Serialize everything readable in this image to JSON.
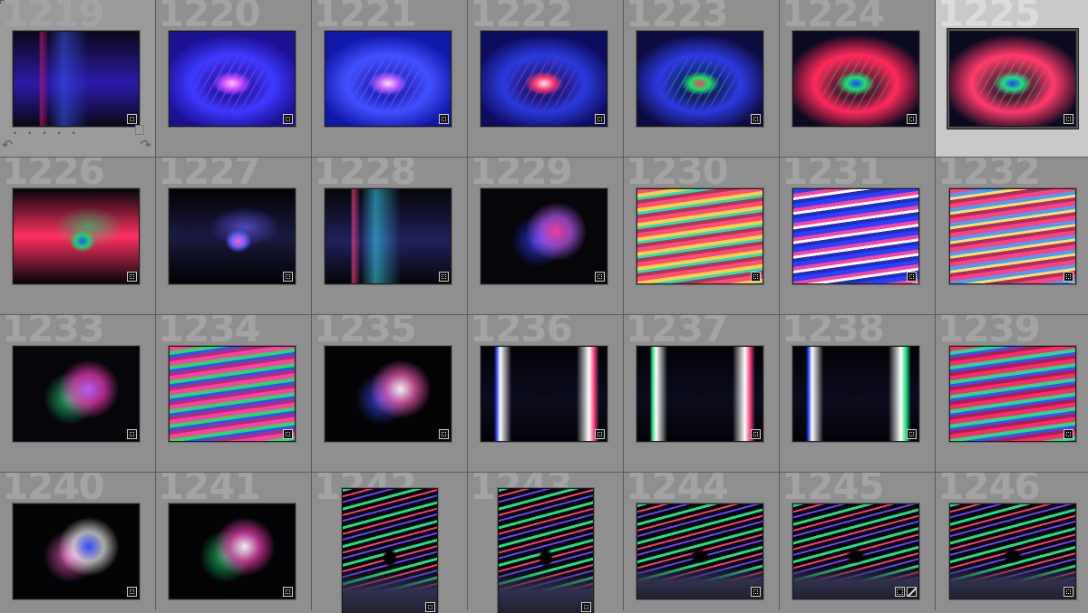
{
  "window": {
    "app": "Lightroom Library Grid"
  },
  "colors": {
    "cell_bg": "#8f8f8f",
    "cell_selected_bg": "#c9c9c9",
    "index_number": "#a3a3a3",
    "grid_line": "#5a5a5a"
  },
  "hover_controls": {
    "stars": "• • • • •",
    "rotate_left_icon": "rotate-left-icon",
    "rotate_right_icon": "rotate-right-icon"
  },
  "cells": [
    {
      "index": "1219",
      "orientation": "landscape",
      "selected": false,
      "hover": true,
      "palette": [
        "#0a0818",
        "#2a1aa8",
        "#c0146a",
        "#3a5af0"
      ],
      "style": "subway"
    },
    {
      "index": "1220",
      "orientation": "landscape",
      "selected": false,
      "palette": [
        "#1a1090",
        "#3d38ff",
        "#c84cff",
        "#ffc0ff"
      ],
      "style": "tunnel"
    },
    {
      "index": "1221",
      "orientation": "landscape",
      "selected": false,
      "palette": [
        "#1018a8",
        "#4050ff",
        "#c060ff",
        "#ffe0ff"
      ],
      "style": "tunnel"
    },
    {
      "index": "1222",
      "orientation": "landscape",
      "selected": false,
      "palette": [
        "#0c0c60",
        "#2a3adc",
        "#ff3a6a",
        "#ffe6ff"
      ],
      "style": "tunnel"
    },
    {
      "index": "1223",
      "orientation": "landscape",
      "selected": false,
      "palette": [
        "#0c0c40",
        "#2c3ae0",
        "#20e060",
        "#ff3a6a"
      ],
      "style": "tunnel"
    },
    {
      "index": "1224",
      "orientation": "landscape",
      "selected": false,
      "palette": [
        "#0a0a20",
        "#ff2a5a",
        "#20e070",
        "#2040ff"
      ],
      "style": "tunnel"
    },
    {
      "index": "1225",
      "orientation": "landscape",
      "selected": true,
      "palette": [
        "#0a0a20",
        "#ff3a6a",
        "#20e080",
        "#2040ff"
      ],
      "style": "tunnel"
    },
    {
      "index": "1226",
      "orientation": "landscape",
      "selected": false,
      "palette": [
        "#05050a",
        "#ff3060",
        "#20d070",
        "#3050ff"
      ],
      "style": "tunnel-dark"
    },
    {
      "index": "1227",
      "orientation": "landscape",
      "selected": false,
      "palette": [
        "#020204",
        "#1a1a40",
        "#6a60ff",
        "#ff60c0"
      ],
      "style": "tunnel-dark"
    },
    {
      "index": "1228",
      "orientation": "landscape",
      "selected": false,
      "palette": [
        "#05060a",
        "#20205a",
        "#ff4080",
        "#40e0ff"
      ],
      "style": "subway"
    },
    {
      "index": "1229",
      "orientation": "landscape",
      "selected": false,
      "palette": [
        "#05050a",
        "#3040ff",
        "#c060ff",
        "#ff40a0"
      ],
      "style": "blur"
    },
    {
      "index": "1230",
      "orientation": "landscape",
      "selected": false,
      "palette": [
        "#200810",
        "#ff4a7a",
        "#ffd040",
        "#20e0c0"
      ],
      "style": "streak"
    },
    {
      "index": "1231",
      "orientation": "landscape",
      "selected": false,
      "palette": [
        "#0a0a30",
        "#2a40ff",
        "#ff40a0",
        "#ffffff"
      ],
      "style": "streak"
    },
    {
      "index": "1232",
      "orientation": "landscape",
      "selected": false,
      "palette": [
        "#0a0a20",
        "#ff4080",
        "#40a0ff",
        "#ffe060"
      ],
      "style": "streak"
    },
    {
      "index": "1233",
      "orientation": "landscape",
      "selected": false,
      "palette": [
        "#05050a",
        "#20e080",
        "#ff40c0",
        "#c060ff"
      ],
      "style": "blur"
    },
    {
      "index": "1234",
      "orientation": "landscape",
      "selected": false,
      "palette": [
        "#0a0a30",
        "#ff40a0",
        "#20e060",
        "#3050ff"
      ],
      "style": "streak"
    },
    {
      "index": "1235",
      "orientation": "landscape",
      "selected": false,
      "palette": [
        "#030305",
        "#4050ff",
        "#ff60c0",
        "#ffffff"
      ],
      "style": "blur"
    },
    {
      "index": "1236",
      "orientation": "landscape",
      "selected": false,
      "palette": [
        "#020206",
        "#2a3aff",
        "#ffffff",
        "#ff4080"
      ],
      "style": "corridor"
    },
    {
      "index": "1237",
      "orientation": "landscape",
      "selected": false,
      "palette": [
        "#020206",
        "#20e080",
        "#ffffff",
        "#ff4080"
      ],
      "style": "corridor"
    },
    {
      "index": "1238",
      "orientation": "landscape",
      "selected": false,
      "palette": [
        "#020206",
        "#2040ff",
        "#ffffff",
        "#20e080"
      ],
      "style": "corridor"
    },
    {
      "index": "1239",
      "orientation": "landscape",
      "selected": false,
      "palette": [
        "#0a0820",
        "#ff2a6a",
        "#20e080",
        "#3a50ff"
      ],
      "style": "streak"
    },
    {
      "index": "1240",
      "orientation": "landscape",
      "selected": false,
      "palette": [
        "#030305",
        "#ff60d0",
        "#ffffff",
        "#3050ff"
      ],
      "style": "blur"
    },
    {
      "index": "1241",
      "orientation": "landscape",
      "selected": false,
      "palette": [
        "#030305",
        "#20e070",
        "#ff40c0",
        "#ffffff"
      ],
      "style": "blur"
    },
    {
      "index": "1242",
      "orientation": "portrait",
      "selected": false,
      "palette": [
        "#05050c",
        "#20e080",
        "#ff3a6a",
        "#6a40ff"
      ],
      "style": "mural"
    },
    {
      "index": "1243",
      "orientation": "portrait",
      "selected": false,
      "palette": [
        "#05050c",
        "#20e080",
        "#ff3a6a",
        "#6a40ff"
      ],
      "style": "mural"
    },
    {
      "index": "1244",
      "orientation": "landscape",
      "selected": false,
      "palette": [
        "#05050c",
        "#20e080",
        "#ff3a6a",
        "#6a40ff"
      ],
      "style": "mural"
    },
    {
      "index": "1245",
      "orientation": "landscape",
      "selected": false,
      "palette": [
        "#05050c",
        "#20e080",
        "#ff3a6a",
        "#6a40ff"
      ],
      "style": "mural",
      "edited": true
    },
    {
      "index": "1246",
      "orientation": "landscape",
      "selected": false,
      "palette": [
        "#05050c",
        "#20e080",
        "#ff3a6a",
        "#6a40ff"
      ],
      "style": "mural"
    }
  ]
}
